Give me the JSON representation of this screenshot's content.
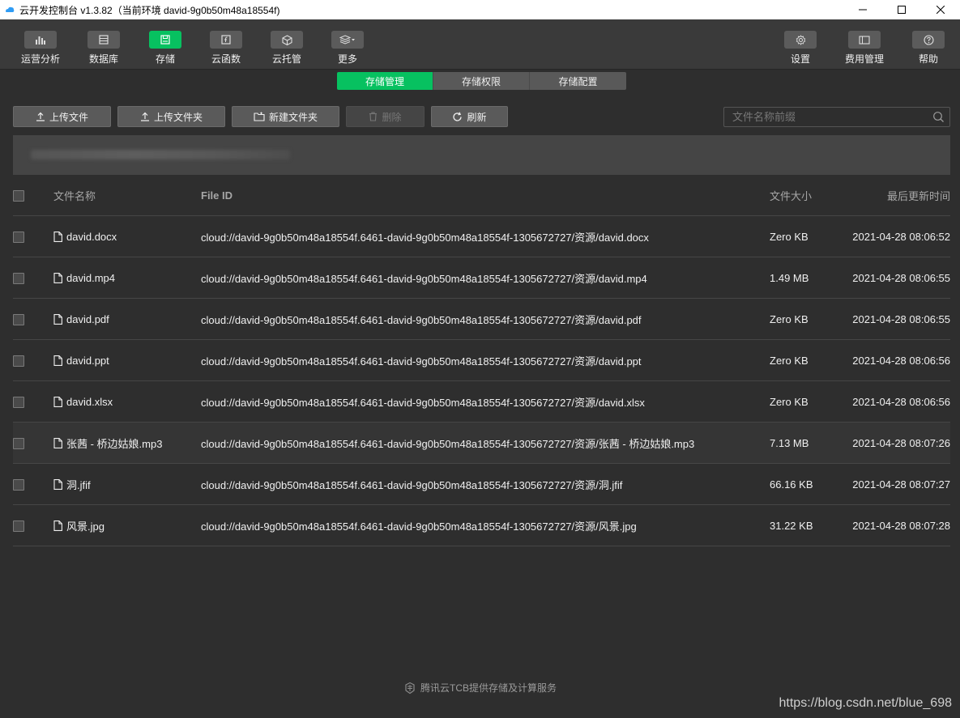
{
  "window": {
    "title": "云开发控制台 v1.3.82（当前环境 david-9g0b50m48a18554f)"
  },
  "toolbar": {
    "left": [
      {
        "label": "运营分析",
        "icon": "bar-chart-icon",
        "active": false
      },
      {
        "label": "数据库",
        "icon": "database-icon",
        "active": false
      },
      {
        "label": "存储",
        "icon": "storage-icon",
        "active": true
      },
      {
        "label": "云函数",
        "icon": "function-icon",
        "active": false
      },
      {
        "label": "云托管",
        "icon": "cube-icon",
        "active": false
      },
      {
        "label": "更多",
        "icon": "layers-icon",
        "active": false
      }
    ],
    "right": [
      {
        "label": "设置",
        "icon": "gear-icon"
      },
      {
        "label": "费用管理",
        "icon": "card-icon"
      },
      {
        "label": "帮助",
        "icon": "question-icon"
      }
    ]
  },
  "tabs": [
    {
      "label": "存储管理",
      "active": true
    },
    {
      "label": "存储权限",
      "active": false
    },
    {
      "label": "存储配置",
      "active": false
    }
  ],
  "actions": {
    "upload_file": "上传文件",
    "upload_folder": "上传文件夹",
    "new_folder": "新建文件夹",
    "delete": "删除",
    "refresh": "刷新"
  },
  "search": {
    "placeholder": "文件名称前缀",
    "value": ""
  },
  "table": {
    "headers": {
      "name": "文件名称",
      "file_id": "File ID",
      "size": "文件大小",
      "updated": "最后更新时间"
    },
    "rows": [
      {
        "name": "david.docx",
        "file_id": "cloud://david-9g0b50m48a18554f.6461-david-9g0b50m48a18554f-1305672727/资源/david.docx",
        "size": "Zero KB",
        "updated": "2021-04-28 08:06:52"
      },
      {
        "name": "david.mp4",
        "file_id": "cloud://david-9g0b50m48a18554f.6461-david-9g0b50m48a18554f-1305672727/资源/david.mp4",
        "size": "1.49 MB",
        "updated": "2021-04-28 08:06:55"
      },
      {
        "name": "david.pdf",
        "file_id": "cloud://david-9g0b50m48a18554f.6461-david-9g0b50m48a18554f-1305672727/资源/david.pdf",
        "size": "Zero KB",
        "updated": "2021-04-28 08:06:55"
      },
      {
        "name": "david.ppt",
        "file_id": "cloud://david-9g0b50m48a18554f.6461-david-9g0b50m48a18554f-1305672727/资源/david.ppt",
        "size": "Zero KB",
        "updated": "2021-04-28 08:06:56"
      },
      {
        "name": "david.xlsx",
        "file_id": "cloud://david-9g0b50m48a18554f.6461-david-9g0b50m48a18554f-1305672727/资源/david.xlsx",
        "size": "Zero KB",
        "updated": "2021-04-28 08:06:56"
      },
      {
        "name": "张茜 - 桥边姑娘.mp3",
        "file_id": "cloud://david-9g0b50m48a18554f.6461-david-9g0b50m48a18554f-1305672727/资源/张茜 - 桥边姑娘.mp3",
        "size": "7.13 MB",
        "updated": "2021-04-28 08:07:26"
      },
      {
        "name": "洞.jfif",
        "file_id": "cloud://david-9g0b50m48a18554f.6461-david-9g0b50m48a18554f-1305672727/资源/洞.jfif",
        "size": "66.16 KB",
        "updated": "2021-04-28 08:07:27"
      },
      {
        "name": "风景.jpg",
        "file_id": "cloud://david-9g0b50m48a18554f.6461-david-9g0b50m48a18554f-1305672727/资源/风景.jpg",
        "size": "31.22 KB",
        "updated": "2021-04-28 08:07:28"
      }
    ]
  },
  "footer": {
    "text": "腾讯云TCB提供存储及计算服务"
  },
  "watermark": "https://blog.csdn.net/blue_698",
  "colors": {
    "accent": "#07c160",
    "background": "#2e2e2e",
    "toolbar": "#3a3a3a"
  }
}
